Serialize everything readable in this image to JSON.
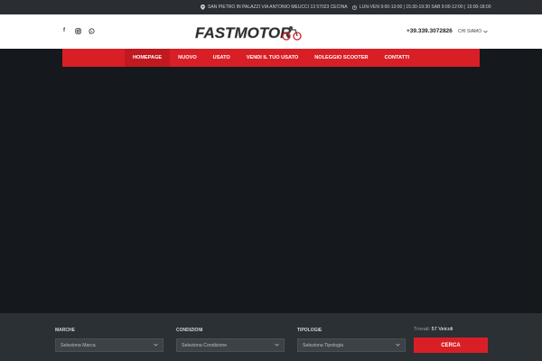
{
  "topbar": {
    "address": "SAN PIETRO IN PALAZZI VIA ANTONIO MEUCCI 13 57023 CECINA",
    "hours": "LUN-VEN 9:00-13:00 | 15:30-19:30 SAB 9:00-12:00 | 15:00-18:00"
  },
  "header": {
    "logo_text": "FASTMOTOR",
    "phone": "+39.339.3072826",
    "menu_label": "CHI SIAMO"
  },
  "nav": {
    "items": [
      "HOMEPAGE",
      "NUOVO",
      "USATO",
      "VENDI IL TUO USATO",
      "NOLEGGIO SCOOTER",
      "CONTATTI"
    ]
  },
  "search": {
    "marche_label": "MARCHE",
    "marche_value": "Seleziona Marca",
    "condizioni_label": "CONDIZIONI",
    "condizioni_value": "Seleziona Condizione",
    "tipologie_label": "TIPOLOGIE",
    "tipologie_value": "Seleziona Tipologia",
    "found_label": "Trovati:",
    "found_count": "57 Veicoli",
    "button_label": "CERCA"
  },
  "colors": {
    "accent": "#d91f26",
    "dark_bg": "#16191d",
    "panel_bg": "#2b3035"
  }
}
